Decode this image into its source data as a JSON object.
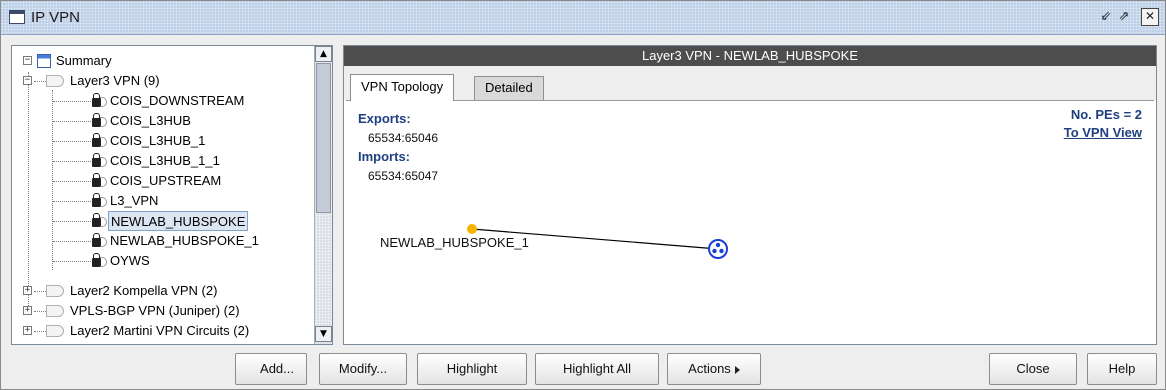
{
  "window": {
    "title": "IP VPN"
  },
  "tree": {
    "root_label": "Summary",
    "groups": [
      {
        "label": "Layer3 VPN (9)",
        "expanded": true,
        "items": [
          "COIS_DOWNSTREAM",
          "COIS_L3HUB",
          "COIS_L3HUB_1",
          "COIS_L3HUB_1_1",
          "COIS_UPSTREAM",
          "L3_VPN",
          "NEWLAB_HUBSPOKE",
          "NEWLAB_HUBSPOKE_1",
          "OYWS"
        ],
        "selected": "NEWLAB_HUBSPOKE"
      },
      {
        "label": "Layer2 Kompella VPN (2)",
        "expanded": false
      },
      {
        "label": "VPLS-BGP VPN (Juniper) (2)",
        "expanded": false
      },
      {
        "label": "Layer2 Martini VPN Circuits (2)",
        "expanded": false
      }
    ]
  },
  "detail": {
    "header": "Layer3 VPN - NEWLAB_HUBSPOKE",
    "tabs": [
      {
        "label": "VPN Topology",
        "active": true
      },
      {
        "label": "Detailed",
        "active": false
      }
    ],
    "exports_label": "Exports:",
    "exports_value": "65534:65046",
    "imports_label": "Imports:",
    "imports_value": "65534:65047",
    "pes_label": "No. PEs = 2",
    "vpn_view_link": "To VPN View",
    "topology": {
      "node_label": "NEWLAB_HUBSPOKE_1",
      "spoke_color": "#f4b400",
      "hub_color": "#1a3fd6"
    }
  },
  "buttons": {
    "add": "Add...",
    "modify": "Modify...",
    "highlight": "Highlight",
    "highlight_all": "Highlight All",
    "actions": "Actions",
    "close": "Close",
    "help": "Help"
  }
}
